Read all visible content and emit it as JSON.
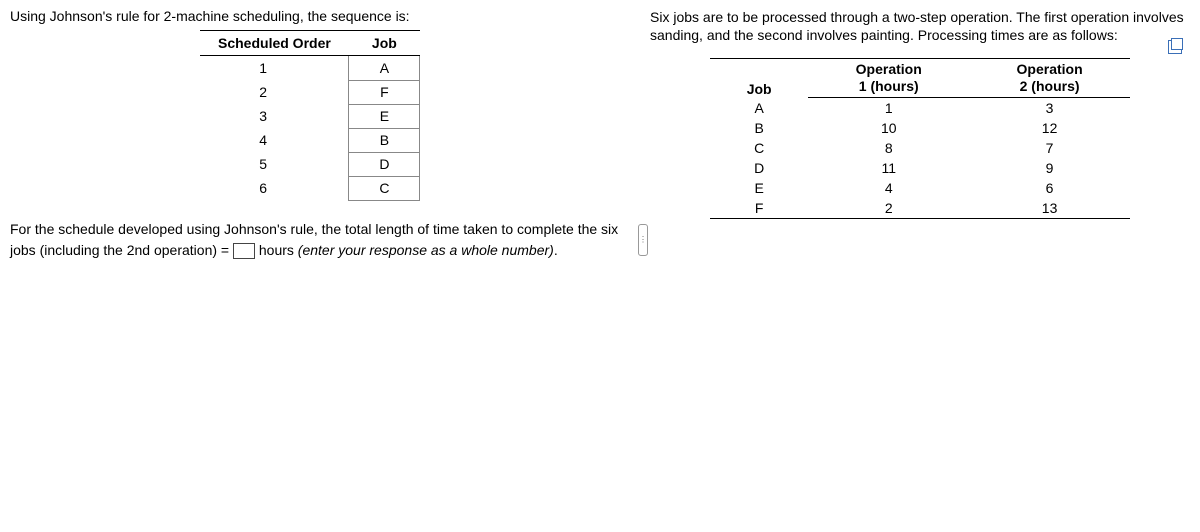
{
  "left": {
    "intro": "Using Johnson's rule for 2-machine scheduling, the sequence is:",
    "sched_headers": {
      "order": "Scheduled Order",
      "job": "Job"
    },
    "sched_rows": [
      {
        "order": "1",
        "job": "A"
      },
      {
        "order": "2",
        "job": "F"
      },
      {
        "order": "3",
        "job": "E"
      },
      {
        "order": "4",
        "job": "B"
      },
      {
        "order": "5",
        "job": "D"
      },
      {
        "order": "6",
        "job": "C"
      }
    ],
    "question_part1": "For the schedule developed using Johnson's rule, the total length of time taken to complete the six jobs (including the 2nd operation) = ",
    "question_part2": " hours ",
    "question_hint": "(enter your response as a whole number)",
    "question_end": "."
  },
  "right": {
    "intro": "Six jobs are to be processed through a two-step operation. The first operation involves sanding, and the second involves painting. Processing times are as follows:",
    "ops_headers": {
      "job": "Job",
      "op1_l1": "Operation",
      "op1_l2": "1 (hours)",
      "op2_l1": "Operation",
      "op2_l2": "2 (hours)"
    },
    "ops_rows": [
      {
        "job": "A",
        "op1": "1",
        "op2": "3"
      },
      {
        "job": "B",
        "op1": "10",
        "op2": "12"
      },
      {
        "job": "C",
        "op1": "8",
        "op2": "7"
      },
      {
        "job": "D",
        "op1": "11",
        "op2": "9"
      },
      {
        "job": "E",
        "op1": "4",
        "op2": "6"
      },
      {
        "job": "F",
        "op1": "2",
        "op2": "13"
      }
    ]
  }
}
